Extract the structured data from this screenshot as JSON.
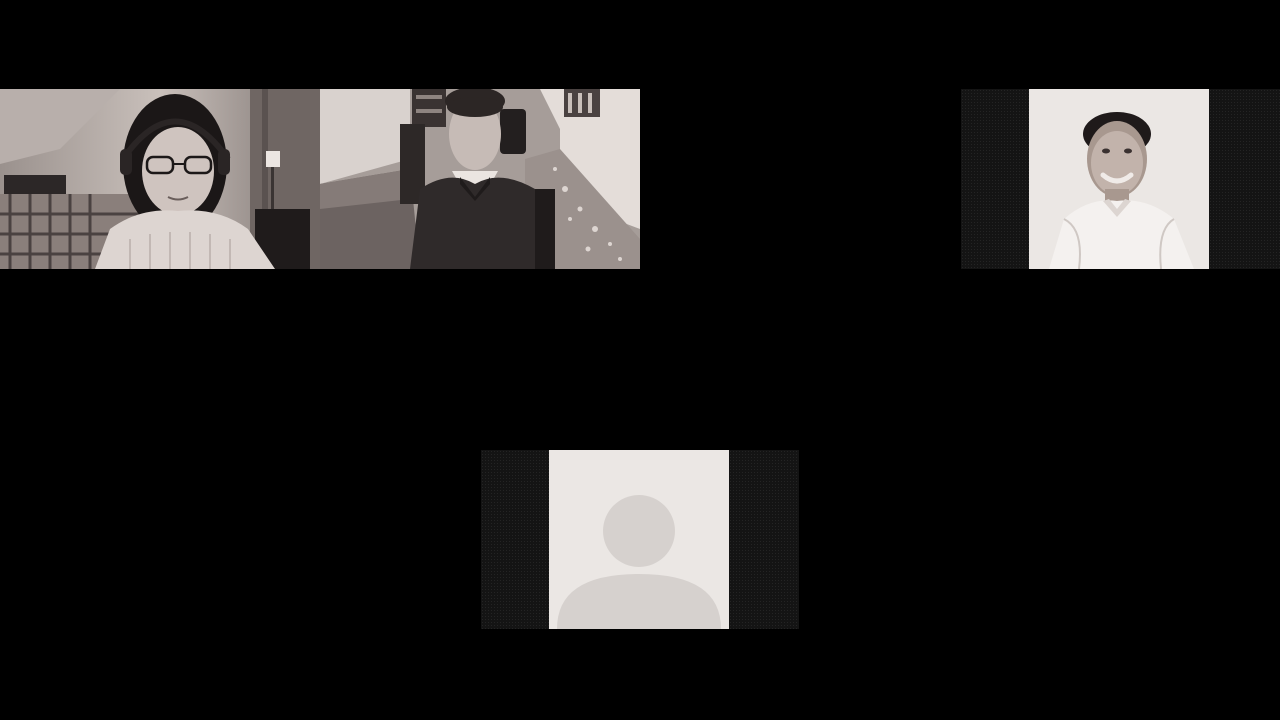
{
  "app": {
    "view": "gallery",
    "background_color": "#000000"
  },
  "participants": [
    {
      "id": "p1",
      "video": "on",
      "icon": "webcam-feed"
    },
    {
      "id": "p2",
      "video": "on",
      "icon": "webcam-feed"
    },
    {
      "id": "p3",
      "video": "profile-photo",
      "icon": "profile-photo"
    },
    {
      "id": "p4",
      "video": "off",
      "icon": "avatar-placeholder-icon"
    }
  ],
  "colors": {
    "portrait_bg": "#ebe7e4",
    "placeholder_fill": "#d6d1ce",
    "pillar": "#141414"
  }
}
